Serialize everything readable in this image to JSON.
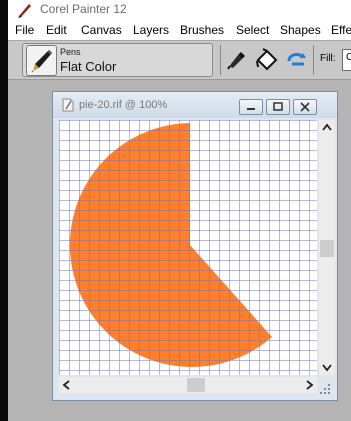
{
  "app": {
    "title": "Corel Painter 12"
  },
  "menu": [
    "File",
    "Edit",
    "Canvas",
    "Layers",
    "Brushes",
    "Select",
    "Shapes",
    "Effe"
  ],
  "property_bar": {
    "brush_category": "Pens",
    "brush_variant": "Flat Color",
    "tools": [
      "eyedropper-icon",
      "fill-bucket-icon",
      "rotate-icon"
    ],
    "fill_label": "Fill:",
    "fill_value": "C"
  },
  "document": {
    "title": "pie-20.rif @ 100%",
    "shape_color": "#ff7f2a",
    "grid_color": "#6f73c3",
    "controls": [
      "minimize-icon",
      "maximize-icon",
      "close-icon"
    ]
  },
  "colors": {
    "app_background": "#b4b4b4",
    "document_frame": "#dde6ef"
  }
}
